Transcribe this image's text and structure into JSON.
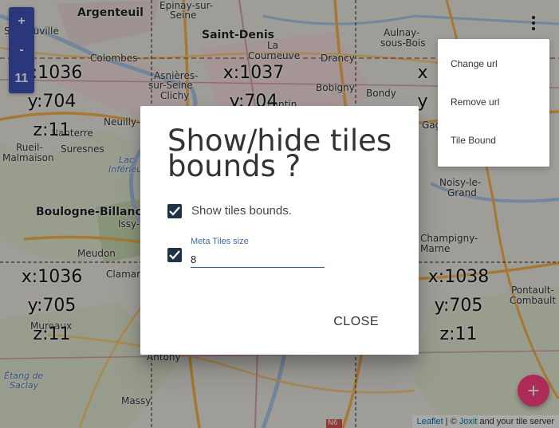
{
  "map": {
    "places": [
      {
        "name": "Argenteuil"
      },
      {
        "name": "Epinay-sur-"
      },
      {
        "name": "Seine"
      },
      {
        "name": "Saint-Denis"
      },
      {
        "name": "La"
      },
      {
        "name": "Courneuve"
      },
      {
        "name": "Aulnay-"
      },
      {
        "name": "sous-Bois"
      },
      {
        "name": "Colombes"
      },
      {
        "name": "Drancy"
      },
      {
        "name": "Asnières-"
      },
      {
        "name": "sur-Seine"
      },
      {
        "name": "Clichy"
      },
      {
        "name": "Bobigny"
      },
      {
        "name": "Bondy"
      },
      {
        "name": "Nanterre"
      },
      {
        "name": "Neuilly-"
      },
      {
        "name": "Rueil-"
      },
      {
        "name": "Malmaison"
      },
      {
        "name": "Suresnes"
      },
      {
        "name": "Boulogne-Billancourt"
      },
      {
        "name": "Issy-"
      },
      {
        "name": "Meudon"
      },
      {
        "name": "Clamart"
      },
      {
        "name": "Gag"
      },
      {
        "name": "Noisy-le-"
      },
      {
        "name": "Grand"
      },
      {
        "name": "Champigny-"
      },
      {
        "name": "Marne"
      },
      {
        "name": "Pontault-"
      },
      {
        "name": "Combault"
      },
      {
        "name": "Antony"
      },
      {
        "name": "Massy"
      },
      {
        "name": "Étang de"
      },
      {
        "name": "Saclay"
      },
      {
        "name": "Lac"
      },
      {
        "name": "Inférieur"
      },
      {
        "name": "N6"
      },
      {
        "name": "Sartrouville"
      },
      {
        "name": "Pantin"
      },
      {
        "name": "Mureaux"
      }
    ],
    "tiles": [
      {
        "x": "x:1036",
        "y": "y:704",
        "z": "z:11"
      },
      {
        "x": "x:1037",
        "y": "y:704",
        "z": ""
      },
      {
        "x": "x:1036",
        "y": "y:705",
        "z": "z:11"
      },
      {
        "x": "x:1038",
        "y": "y:705",
        "z": "z:11"
      },
      {
        "x": "x",
        "y": "y",
        "z": ""
      }
    ]
  },
  "zoom": {
    "in": "+",
    "out": "-",
    "level": "11"
  },
  "dialog": {
    "title": "Show/hide tiles bounds ?",
    "show_bounds_label": "Show tiles bounds.",
    "show_bounds_checked": true,
    "meta_checked": true,
    "meta_label": "Meta Tiles size",
    "meta_value": "8",
    "close": "CLOSE"
  },
  "menu": {
    "items": [
      "Change url",
      "Remove url",
      "Tile Bound"
    ]
  },
  "fab": {
    "label": "+"
  },
  "attribution": {
    "leaflet": "Leaflet",
    "sep": " | © ",
    "jotix": "Joxit",
    "rest": " and your tile server"
  }
}
